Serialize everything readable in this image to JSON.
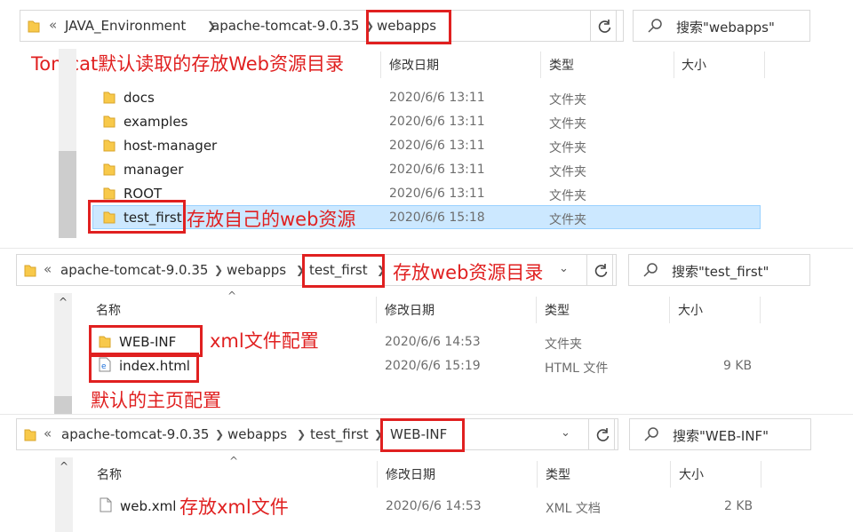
{
  "panel1": {
    "breadcrumb": [
      "JAVA_Environment",
      "apache-tomcat-9.0.35",
      "webapps"
    ],
    "search_placeholder": "搜索\"webapps\"",
    "columns": {
      "date": "修改日期",
      "type": "类型",
      "size": "大小"
    },
    "rows": [
      {
        "name": "docs",
        "date": "2020/6/6 13:11",
        "type": "文件夹"
      },
      {
        "name": "examples",
        "date": "2020/6/6 13:11",
        "type": "文件夹"
      },
      {
        "name": "host-manager",
        "date": "2020/6/6 13:11",
        "type": "文件夹"
      },
      {
        "name": "manager",
        "date": "2020/6/6 13:11",
        "type": "文件夹"
      },
      {
        "name": "ROOT",
        "date": "2020/6/6 13:11",
        "type": "文件夹"
      },
      {
        "name": "test_first",
        "date": "2020/6/6 15:18",
        "type": "文件夹"
      }
    ],
    "annotations": {
      "top": "Tomcat默认读取的存放Web资源目录",
      "row": "存放自己的web资源"
    }
  },
  "panel2": {
    "breadcrumb": [
      "apache-tomcat-9.0.35",
      "webapps",
      "test_first"
    ],
    "search_placeholder": "搜索\"test_first\"",
    "columns": {
      "name": "名称",
      "date": "修改日期",
      "type": "类型",
      "size": "大小"
    },
    "rows": [
      {
        "name": "WEB-INF",
        "date": "2020/6/6 14:53",
        "type": "文件夹",
        "size": ""
      },
      {
        "name": "index.html",
        "date": "2020/6/6 15:19",
        "type": "HTML 文件",
        "size": "9 KB"
      }
    ],
    "annotations": {
      "address": "存放web资源目录",
      "webinf": "xml文件配置",
      "index": "默认的主页配置"
    }
  },
  "panel3": {
    "breadcrumb": [
      "apache-tomcat-9.0.35",
      "webapps",
      "test_first",
      "WEB-INF"
    ],
    "search_placeholder": "搜索\"WEB-INF\"",
    "columns": {
      "name": "名称",
      "date": "修改日期",
      "type": "类型",
      "size": "大小"
    },
    "rows": [
      {
        "name": "web.xml",
        "date": "2020/6/6 14:53",
        "type": "XML 文档",
        "size": "2 KB"
      }
    ],
    "annotations": {
      "row": "存放xml文件"
    }
  },
  "colors": {
    "annotation_red": "#e02020",
    "selection": "#cce8ff",
    "folder": "#f8c94a"
  }
}
